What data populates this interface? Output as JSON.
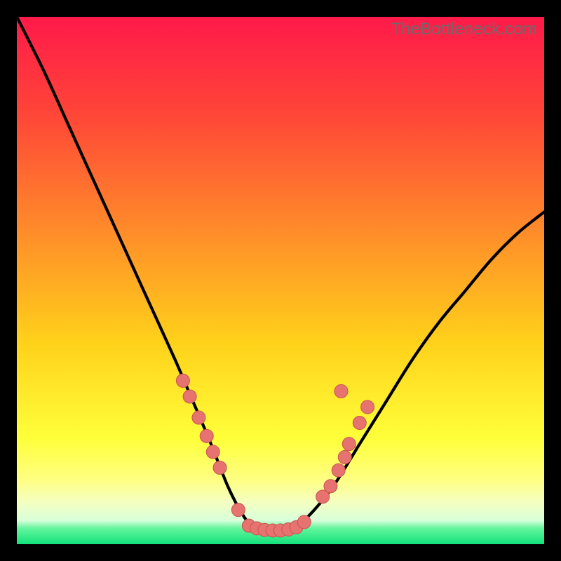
{
  "watermark": "TheBottleneck.com",
  "colors": {
    "frame": "#000000",
    "grad_top": "#ff1a4a",
    "grad_mid1": "#ff6a2a",
    "grad_mid2": "#ffd21a",
    "grad_low": "#ffff60",
    "grad_band": "#f6ffb0",
    "grad_green": "#1fe97f",
    "curve": "#000000",
    "dot_fill": "#e6736f",
    "dot_stroke": "#c95550"
  },
  "chart_data": {
    "type": "line",
    "title": "",
    "xlabel": "",
    "ylabel": "",
    "xlim": [
      0,
      100
    ],
    "ylim": [
      0,
      100
    ],
    "series": [
      {
        "name": "bottleneck-curve",
        "x": [
          0,
          5,
          10,
          15,
          20,
          25,
          30,
          33,
          36,
          38,
          40,
          42,
          44,
          46,
          48,
          50,
          52,
          55,
          60,
          65,
          70,
          75,
          80,
          85,
          90,
          95,
          100
        ],
        "y": [
          100,
          90,
          79,
          68,
          57,
          46,
          35,
          28,
          21,
          16,
          11,
          7,
          4,
          3,
          2.5,
          2.5,
          3,
          5,
          11,
          19,
          27,
          35,
          42,
          48,
          54,
          59,
          63
        ]
      }
    ],
    "scatter": {
      "name": "sample-points",
      "points": [
        {
          "x": 31.5,
          "y": 31
        },
        {
          "x": 32.8,
          "y": 28
        },
        {
          "x": 34.5,
          "y": 24
        },
        {
          "x": 36.0,
          "y": 20.5
        },
        {
          "x": 37.2,
          "y": 17.5
        },
        {
          "x": 38.5,
          "y": 14.5
        },
        {
          "x": 42.0,
          "y": 6.5
        },
        {
          "x": 44.0,
          "y": 3.5
        },
        {
          "x": 45.5,
          "y": 3.0
        },
        {
          "x": 47.0,
          "y": 2.7
        },
        {
          "x": 48.5,
          "y": 2.6
        },
        {
          "x": 50.0,
          "y": 2.6
        },
        {
          "x": 51.5,
          "y": 2.8
        },
        {
          "x": 53.0,
          "y": 3.2
        },
        {
          "x": 54.5,
          "y": 4.2
        },
        {
          "x": 58.0,
          "y": 9
        },
        {
          "x": 59.5,
          "y": 11
        },
        {
          "x": 61.0,
          "y": 14
        },
        {
          "x": 62.2,
          "y": 16.5
        },
        {
          "x": 63.0,
          "y": 19
        },
        {
          "x": 65.0,
          "y": 23
        },
        {
          "x": 66.5,
          "y": 26
        },
        {
          "x": 61.5,
          "y": 29
        }
      ]
    }
  }
}
